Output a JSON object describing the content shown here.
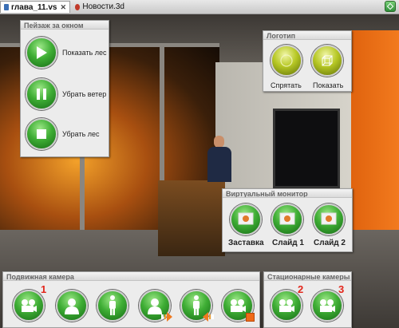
{
  "tabs": [
    {
      "label": "глава_11.vs",
      "close": "✕",
      "icon": "tab-scene-icon"
    },
    {
      "label": "Новости.3d",
      "icon": "tab-3d-icon"
    }
  ],
  "panels": {
    "landscape": {
      "title": "Пейзаж за окном",
      "buttons": [
        {
          "label": "Показать лес",
          "icon": "play-icon"
        },
        {
          "label": "Убрать ветер",
          "icon": "pause-icon"
        },
        {
          "label": "Убрать лес",
          "icon": "stop-icon"
        }
      ]
    },
    "logo": {
      "title": "Логотип",
      "buttons": [
        {
          "label": "Спрятать",
          "icon": "hide-logo-icon"
        },
        {
          "label": "Показать",
          "icon": "show-logo-cube-icon"
        }
      ]
    },
    "monitor": {
      "title": "Виртуальный монитор",
      "buttons": [
        {
          "label": "Заставка",
          "icon": "monitor-screensaver-icon"
        },
        {
          "label": "Слайд 1",
          "icon": "monitor-slide-icon"
        },
        {
          "label": "Слайд 2",
          "icon": "monitor-slide-icon"
        }
      ]
    },
    "moving_camera": {
      "title": "Подвижная камера",
      "buttons": [
        {
          "icon": "camera-icon",
          "number": "1"
        },
        {
          "icon": "person-closeup-icon"
        },
        {
          "icon": "person-fullbody-icon"
        },
        {
          "icon": "person-zoom-in-icon"
        },
        {
          "icon": "person-zoom-out-icon"
        },
        {
          "icon": "camera-record-icon"
        }
      ]
    },
    "static_cameras": {
      "title": "Стационарные камеры",
      "buttons": [
        {
          "icon": "camera-icon",
          "number": "2"
        },
        {
          "icon": "camera-icon",
          "number": "3"
        }
      ]
    }
  },
  "colors": {
    "button_green": "#3fae35",
    "logo_button_yellow": "#b7c825",
    "camera_number_red": "#e3261b",
    "wall_orange": "#f27a1e"
  }
}
